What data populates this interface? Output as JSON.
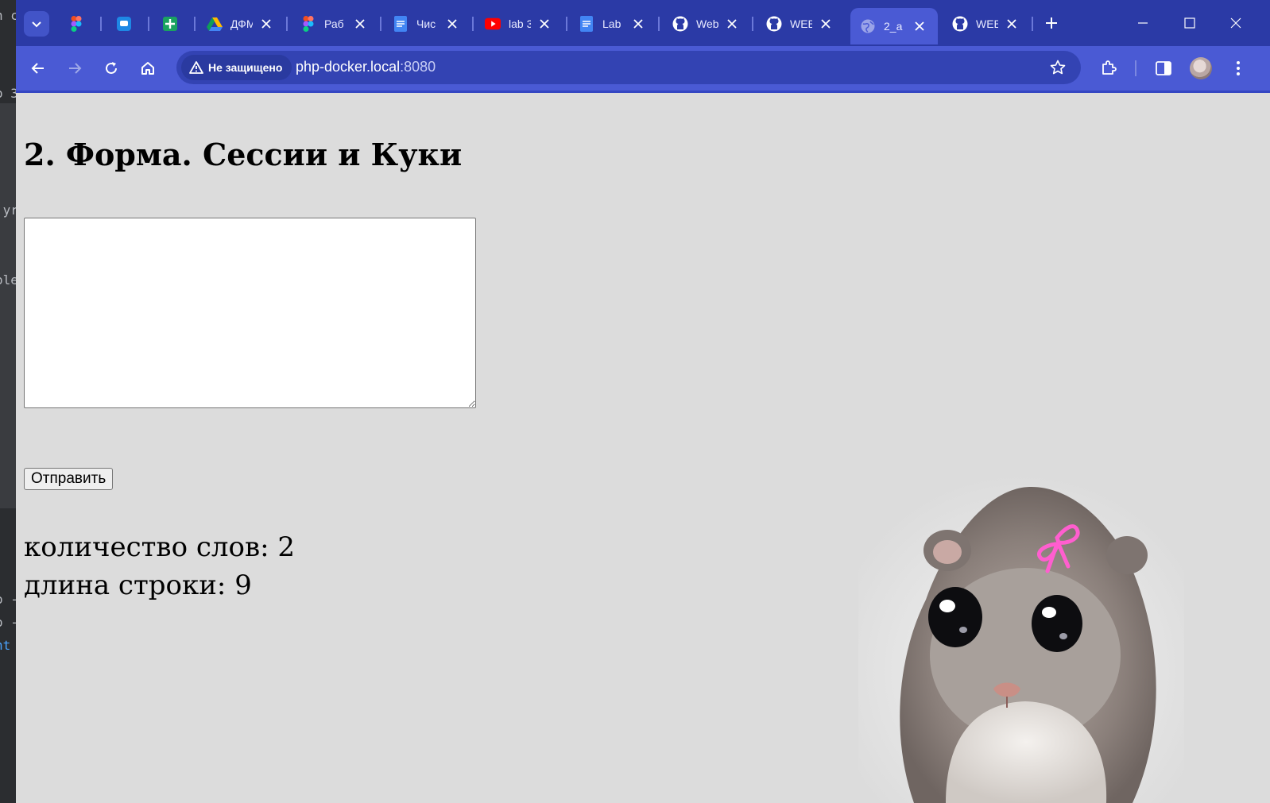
{
  "tabs": [
    {
      "label": "",
      "icon": "figma-icon",
      "active": false
    },
    {
      "label": "",
      "icon": "chat-icon",
      "active": false
    },
    {
      "label": "",
      "icon": "google-sheets-icon",
      "active": false
    },
    {
      "label": "ДФМ",
      "icon": "google-drive-icon",
      "active": false
    },
    {
      "label": "Раб",
      "icon": "figma-icon",
      "active": false
    },
    {
      "label": "Чис",
      "icon": "google-docs-icon",
      "active": false
    },
    {
      "label": "lab 3",
      "icon": "youtube-icon",
      "active": false
    },
    {
      "label": "Lab",
      "icon": "google-docs-icon",
      "active": false
    },
    {
      "label": "Web",
      "icon": "github-icon",
      "active": false
    },
    {
      "label": "WEB",
      "icon": "github-icon",
      "active": false
    },
    {
      "label": "2_a",
      "icon": "globe-icon",
      "active": true
    },
    {
      "label": "WEB",
      "icon": "github-icon",
      "active": false
    }
  ],
  "address_bar": {
    "security_label": "Не защищено",
    "host": "php-docker.local",
    "port": ":8080"
  },
  "page": {
    "title": "2. Форма. Сессии и Куки",
    "textarea_value": "",
    "submit_label": "Отправить",
    "word_count_text": "количество слов: 2",
    "string_length_text": "длина строки: 9"
  },
  "background_ide_fragments": [
    "h c",
    "o 3",
    ".yr",
    "ole",
    "o -",
    "o -",
    "nt"
  ],
  "colors": {
    "tab_strip": "#2b3aa6",
    "toolbar": "#4a5ad4",
    "page_background": "#dcdcdc"
  }
}
